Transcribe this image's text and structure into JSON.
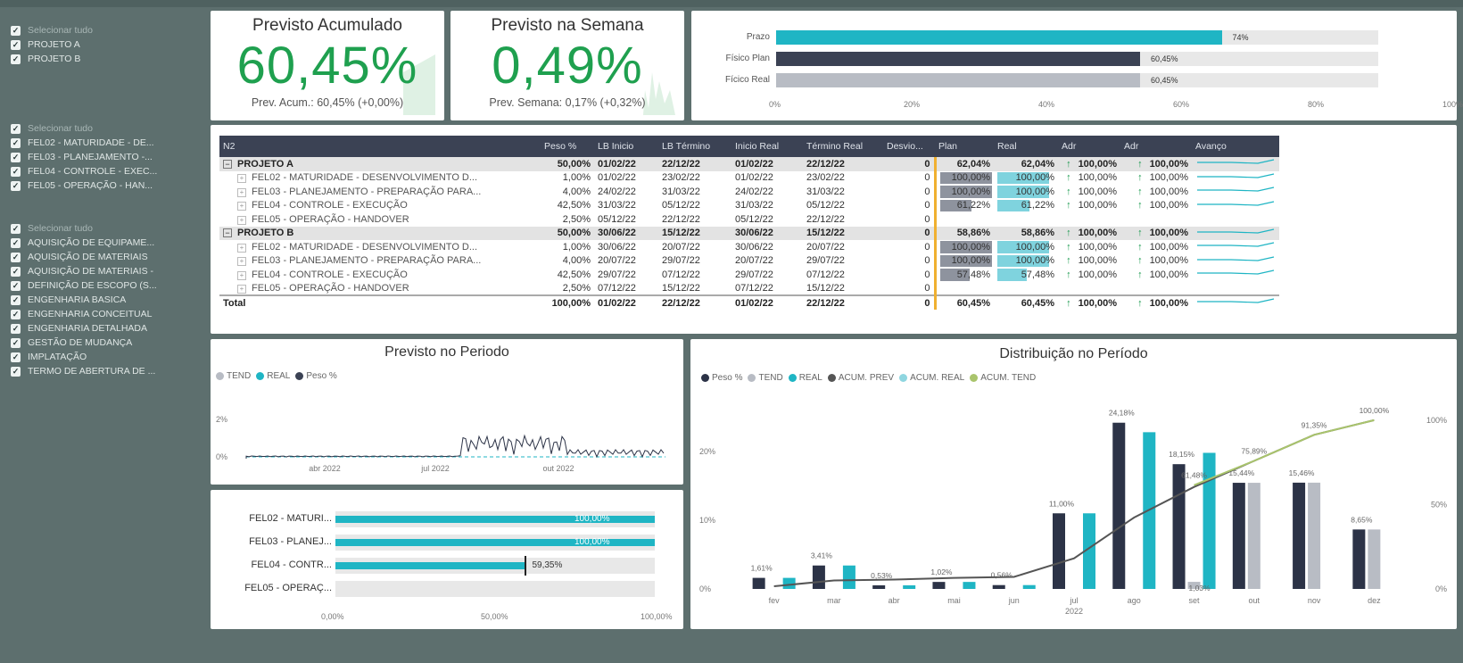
{
  "slicers": {
    "projects": [
      {
        "label": "Selecionar tudo",
        "muted": true
      },
      {
        "label": "PROJETO A"
      },
      {
        "label": "PROJETO B"
      }
    ],
    "phases": [
      {
        "label": "Selecionar tudo",
        "muted": true
      },
      {
        "label": "FEL02 - MATURIDADE - DE..."
      },
      {
        "label": "FEL03 - PLANEJAMENTO -..."
      },
      {
        "label": "FEL04 - CONTROLE - EXEC..."
      },
      {
        "label": "FEL05 - OPERAÇÃO - HAN..."
      }
    ],
    "disciplines": [
      {
        "label": "Selecionar tudo",
        "muted": true
      },
      {
        "label": "AQUISIÇÃO DE EQUIPAME..."
      },
      {
        "label": "AQUISIÇÃO DE MATERIAIS"
      },
      {
        "label": "AQUISIÇÃO DE MATERIAIS -"
      },
      {
        "label": "DEFINIÇÃO DE ESCOPO (S..."
      },
      {
        "label": "ENGENHARIA BASICA"
      },
      {
        "label": "ENGENHARIA CONCEITUAL"
      },
      {
        "label": "ENGENHARIA DETALHADA"
      },
      {
        "label": "GESTÃO DE MUDANÇA"
      },
      {
        "label": "IMPLATAÇÃO"
      },
      {
        "label": "TERMO DE ABERTURA DE ..."
      }
    ]
  },
  "kpi_acum": {
    "title": "Previsto Acumulado",
    "value": "60,45%",
    "sub": "Prev. Acum.: 60,45% (+0,00%)"
  },
  "kpi_semana": {
    "title": "Previsto na Semana",
    "value": "0,49%",
    "sub": "Prev. Semana: 0,17% (+0,32%)"
  },
  "progress": {
    "rows": [
      {
        "label": "Prazo",
        "value": 0.74,
        "text": "74%",
        "color": "#1fb5c4"
      },
      {
        "label": "Físico Plan",
        "value": 0.6045,
        "text": "60,45%",
        "color": "#3b4254"
      },
      {
        "label": "Fícico Real",
        "value": 0.6045,
        "text": "60,45%",
        "color": "#b8bcc4"
      }
    ],
    "ticks": [
      "0%",
      "20%",
      "40%",
      "60%",
      "80%",
      "100%"
    ]
  },
  "matrix": {
    "headers": [
      "N2",
      "Peso %",
      "LB Inicio",
      "LB Término",
      "Inicio Real",
      "Término Real",
      "Desvio...",
      "Plan",
      "Real",
      "Adr",
      "Adr",
      "Avanço"
    ],
    "rows": [
      {
        "type": "grp",
        "name": "PROJETO A",
        "peso": "50,00%",
        "lbi": "01/02/22",
        "lbt": "22/12/22",
        "ir": "01/02/22",
        "tr": "22/12/22",
        "desvio": "0",
        "plan": "62,04%",
        "real": "62,04%",
        "adr1": "100,00%",
        "adr2": "100,00%",
        "plan_fill": 0,
        "real_fill": 0
      },
      {
        "type": "child",
        "name": "FEL02 - MATURIDADE - DESENVOLVIMENTO D...",
        "peso": "1,00%",
        "lbi": "01/02/22",
        "lbt": "23/02/22",
        "ir": "01/02/22",
        "tr": "23/02/22",
        "desvio": "0",
        "plan": "100,00%",
        "real": "100,00%",
        "adr1": "100,00%",
        "adr2": "100,00%",
        "plan_fill": 1.0,
        "real_fill": 1.0
      },
      {
        "type": "child",
        "name": "FEL03 - PLANEJAMENTO - PREPARAÇÃO PARA...",
        "peso": "4,00%",
        "lbi": "24/02/22",
        "lbt": "31/03/22",
        "ir": "24/02/22",
        "tr": "31/03/22",
        "desvio": "0",
        "plan": "100,00%",
        "real": "100,00%",
        "adr1": "100,00%",
        "adr2": "100,00%",
        "plan_fill": 1.0,
        "real_fill": 1.0
      },
      {
        "type": "child",
        "name": "FEL04 - CONTROLE - EXECUÇÃO",
        "peso": "42,50%",
        "lbi": "31/03/22",
        "lbt": "05/12/22",
        "ir": "31/03/22",
        "tr": "05/12/22",
        "desvio": "0",
        "plan": "61,22%",
        "real": "61,22%",
        "adr1": "100,00%",
        "adr2": "100,00%",
        "plan_fill": 0.6122,
        "real_fill": 0.6122
      },
      {
        "type": "child",
        "name": "FEL05 - OPERAÇÃO - HANDOVER",
        "peso": "2,50%",
        "lbi": "05/12/22",
        "lbt": "22/12/22",
        "ir": "05/12/22",
        "tr": "22/12/22",
        "desvio": "0",
        "plan": "",
        "real": "",
        "adr1": "",
        "adr2": "",
        "plan_fill": 0,
        "real_fill": 0
      },
      {
        "type": "grp",
        "name": "PROJETO B",
        "peso": "50,00%",
        "lbi": "30/06/22",
        "lbt": "15/12/22",
        "ir": "30/06/22",
        "tr": "15/12/22",
        "desvio": "0",
        "plan": "58,86%",
        "real": "58,86%",
        "adr1": "100,00%",
        "adr2": "100,00%",
        "plan_fill": 0,
        "real_fill": 0
      },
      {
        "type": "child",
        "name": "FEL02 - MATURIDADE - DESENVOLVIMENTO D...",
        "peso": "1,00%",
        "lbi": "30/06/22",
        "lbt": "20/07/22",
        "ir": "30/06/22",
        "tr": "20/07/22",
        "desvio": "0",
        "plan": "100,00%",
        "real": "100,00%",
        "adr1": "100,00%",
        "adr2": "100,00%",
        "plan_fill": 1.0,
        "real_fill": 1.0
      },
      {
        "type": "child",
        "name": "FEL03 - PLANEJAMENTO - PREPARAÇÃO PARA...",
        "peso": "4,00%",
        "lbi": "20/07/22",
        "lbt": "29/07/22",
        "ir": "20/07/22",
        "tr": "29/07/22",
        "desvio": "0",
        "plan": "100,00%",
        "real": "100,00%",
        "adr1": "100,00%",
        "adr2": "100,00%",
        "plan_fill": 1.0,
        "real_fill": 1.0
      },
      {
        "type": "child",
        "name": "FEL04 - CONTROLE - EXECUÇÃO",
        "peso": "42,50%",
        "lbi": "29/07/22",
        "lbt": "07/12/22",
        "ir": "29/07/22",
        "tr": "07/12/22",
        "desvio": "0",
        "plan": "57,48%",
        "real": "57,48%",
        "adr1": "100,00%",
        "adr2": "100,00%",
        "plan_fill": 0.5748,
        "real_fill": 0.5748
      },
      {
        "type": "child",
        "name": "FEL05 - OPERAÇÃO - HANDOVER",
        "peso": "2,50%",
        "lbi": "07/12/22",
        "lbt": "15/12/22",
        "ir": "07/12/22",
        "tr": "15/12/22",
        "desvio": "0",
        "plan": "",
        "real": "",
        "adr1": "",
        "adr2": "",
        "plan_fill": 0,
        "real_fill": 0
      },
      {
        "type": "tot",
        "name": "Total",
        "peso": "100,00%",
        "lbi": "01/02/22",
        "lbt": "22/12/22",
        "ir": "01/02/22",
        "tr": "22/12/22",
        "desvio": "0",
        "plan": "60,45%",
        "real": "60,45%",
        "adr1": "100,00%",
        "adr2": "100,00%",
        "plan_fill": 0,
        "real_fill": 0
      }
    ]
  },
  "periodo": {
    "title": "Previsto no Periodo",
    "legend": [
      {
        "label": "TEND",
        "color": "#b8bcc4"
      },
      {
        "label": "REAL",
        "color": "#1fb5c4"
      },
      {
        "label": "Peso %",
        "color": "#3b4254"
      }
    ],
    "y_ticks": [
      "2%",
      "0%"
    ],
    "x_ticks": [
      "abr 2022",
      "jul 2022",
      "out 2022"
    ]
  },
  "fase_bars": {
    "rows": [
      {
        "label": "FEL02 - MATURI...",
        "value": 1.0,
        "text": "100,00%"
      },
      {
        "label": "FEL03 - PLANEJ...",
        "value": 1.0,
        "text": "100,00%"
      },
      {
        "label": "FEL04 - CONTR...",
        "value": 0.5935,
        "text": "59,35%"
      },
      {
        "label": "FEL05 - OPERAÇ...",
        "value": 0,
        "text": ""
      }
    ],
    "ticks": [
      "0,00%",
      "50,00%",
      "100,00%"
    ]
  },
  "chart_data": {
    "type": "bar",
    "title": "Distribuição no Período",
    "categories": [
      "fev",
      "mar",
      "abr",
      "mai",
      "jun",
      "jul",
      "ago",
      "set",
      "out",
      "nov",
      "dez"
    ],
    "x_sublabel": "2022",
    "series": [
      {
        "name": "Peso %",
        "color": "#2c3347",
        "values": [
          1.61,
          3.41,
          0.53,
          1.02,
          0.56,
          11.0,
          24.18,
          18.15,
          15.44,
          15.46,
          8.65
        ]
      },
      {
        "name": "TEND",
        "color": "#b8bcc4",
        "values": [
          0,
          0,
          0,
          0,
          0,
          0,
          0,
          1.03,
          15.44,
          15.46,
          8.65
        ]
      },
      {
        "name": "REAL",
        "color": "#1fb5c4",
        "values": [
          1.61,
          3.41,
          0.53,
          1.02,
          0.56,
          11.0,
          22.8,
          19.8,
          0,
          0,
          0
        ]
      },
      {
        "name": "ACUM. PREV",
        "color": "#555555",
        "values": [
          1.61,
          5.02,
          5.55,
          6.57,
          7.13,
          18.13,
          42.31,
          60.46,
          75.9,
          91.35,
          100.0
        ]
      },
      {
        "name": "ACUM. REAL",
        "color": "#8fd6e0",
        "values": [
          1.61,
          5.02,
          5.55,
          6.57,
          7.13,
          18.13,
          42.31,
          61.48,
          0,
          0,
          0
        ]
      },
      {
        "name": "ACUM. TEND",
        "color": "#a9c46c",
        "values": [
          0,
          0,
          0,
          0,
          0,
          0,
          0,
          61.48,
          75.89,
          91.35,
          100.0
        ]
      }
    ],
    "data_labels": [
      "1,61%",
      "3,41%",
      "0,53%",
      "1,02%",
      "0,56%",
      "11,00%",
      "24,18%",
      "18,15%",
      "15,44%",
      "15,46%",
      "8,65%"
    ],
    "line_labels": [
      "61,48%",
      "75,89%",
      "91,35%",
      "100,00%",
      "1,03%"
    ],
    "y_left_ticks": [
      "20%",
      "10%",
      "0%"
    ],
    "y_right_ticks": [
      "100%",
      "50%",
      "0%"
    ],
    "y_left_range": [
      0,
      27
    ],
    "y_right_range": [
      0,
      110
    ]
  }
}
